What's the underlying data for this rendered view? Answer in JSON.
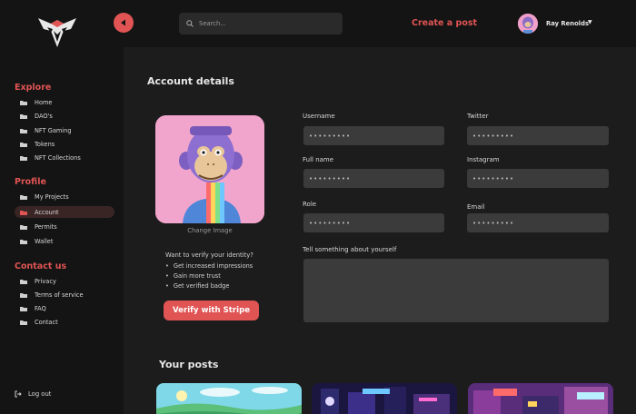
{
  "topbar": {
    "search_placeholder": "Search...",
    "create_post": "Create a post",
    "user_name": "Ray Renolds",
    "user_caret": "▼"
  },
  "sidebar": {
    "sections": [
      {
        "title": "Explore",
        "items": [
          "Home",
          "DAO's",
          "NFT Gaming",
          "Tokens",
          "NFT Collections"
        ]
      },
      {
        "title": "Profile",
        "items": [
          "My Projects",
          "Account",
          "Permits",
          "Wallet"
        ]
      },
      {
        "title": "Contact us",
        "items": [
          "Privacy",
          "Terms of service",
          "FAQ",
          "Contact"
        ]
      }
    ],
    "active_item": "Account",
    "logout": "Log out"
  },
  "main": {
    "title": "Account details",
    "change_image": "Change Image",
    "verify_question": "Want to verify your identity?",
    "benefits": [
      "Get increased impressions",
      "Gain more trust",
      "Get verified badge"
    ],
    "verify_button": "Verify with Stripe",
    "fields": {
      "username": {
        "label": "Username",
        "value": "•••••••••"
      },
      "twitter": {
        "label": "Twitter",
        "value": "•••••••••"
      },
      "full_name": {
        "label": "Full name",
        "value": "•••••••••"
      },
      "instagram": {
        "label": "Instagram",
        "value": "•••••••••"
      },
      "role": {
        "label": "Role",
        "value": "•••••••••"
      },
      "email": {
        "label": "Email",
        "value": "•••••••••"
      },
      "about": {
        "label": "Tell something about yourself",
        "value": ""
      }
    },
    "posts_title": "Your posts"
  },
  "colors": {
    "accent": "#e05454",
    "bg": "#1c1c1c",
    "sidebar": "#141414",
    "input": "#3b3b3b"
  }
}
